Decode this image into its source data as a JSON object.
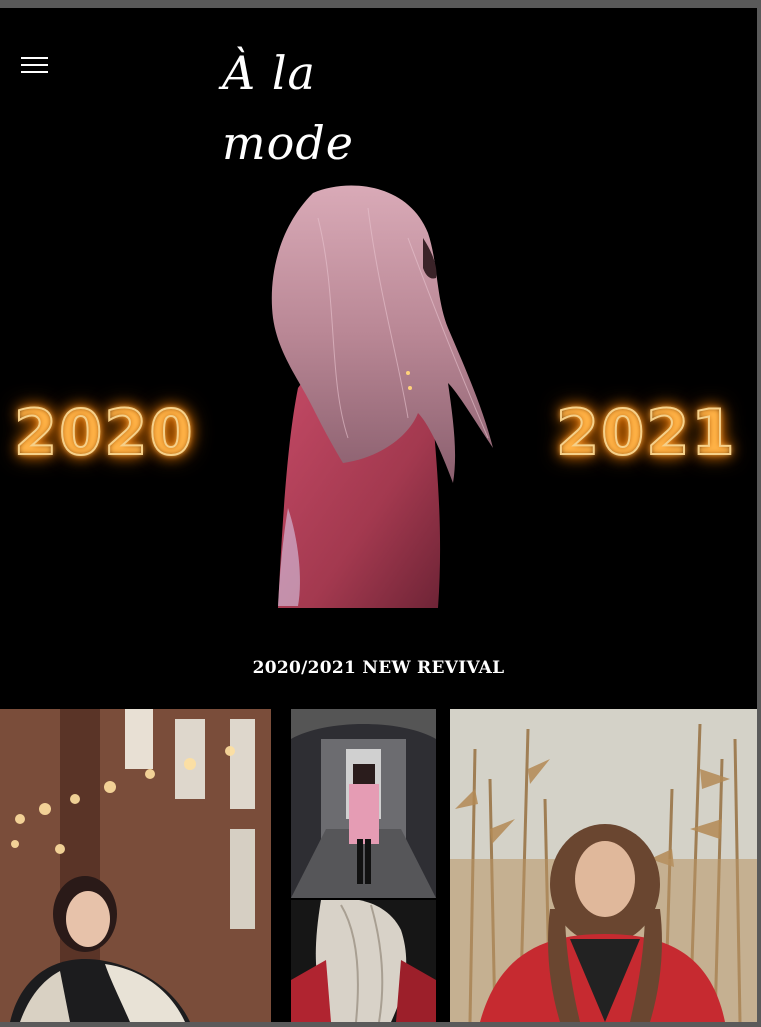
{
  "header": {
    "menu_icon": "hamburger-menu-icon",
    "logo_text": "À la mode"
  },
  "hero": {
    "year_left": "2020",
    "year_right": "2021",
    "sparkler_color": "#f5d08a"
  },
  "section": {
    "headline": "2020/2021 NEW REVIVAL"
  },
  "colors": {
    "background": "#000000",
    "text": "#ffffff",
    "coat": "#b8415a",
    "hair": "#c99aa8"
  }
}
